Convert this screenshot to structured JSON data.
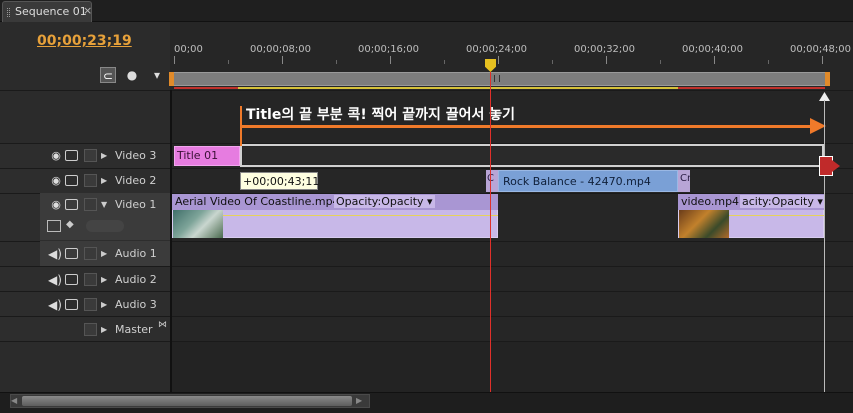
{
  "tab": {
    "label": "Sequence 01",
    "close": "×"
  },
  "header": {
    "timecode": "00;00;23;19"
  },
  "ruler": {
    "labels": [
      "00;00",
      "00;00;08;00",
      "00;00;16;00",
      "00;00;24;00",
      "00;00;32;00",
      "00;00;40;00",
      "00;00;48;00"
    ]
  },
  "annotation": {
    "text": "Title의 끝 부분 콕! 찍어 끝까지 끌어서 놓기"
  },
  "tooltip": {
    "text": "+00;00;43;11"
  },
  "tracks": {
    "video3": {
      "name": "Video 3"
    },
    "video2": {
      "name": "Video 2"
    },
    "video1": {
      "name": "Video 1"
    },
    "audio1": {
      "name": "Audio 1"
    },
    "audio2": {
      "name": "Audio 2"
    },
    "audio3": {
      "name": "Audio 3"
    },
    "master": {
      "name": "Master"
    }
  },
  "clips": {
    "title": "Title 01",
    "trans1": "C",
    "rock": "Rock Balance - 42470.mp4",
    "trans2": "Cr",
    "aerial_name": "Aerial Video Of Coastline.mp4",
    "aerial_opacity": "Opacity:Opacity ▾",
    "video2_name": "video.mp4",
    "video2_opacity": "acity:Opacity ▾"
  },
  "colors": {
    "timecode": "#e7a13a",
    "annotation_arrow": "#f07a2a",
    "playhead": "#e0302a",
    "title_clip": "#e67ce0",
    "video_clip": "#c8b8e8",
    "rock_clip": "#7aa0d6"
  },
  "icons": {
    "eye": "eye-icon",
    "film": "film-icon",
    "speaker": "speaker-icon",
    "snap": "snap-icon",
    "marker": "marker-icon"
  }
}
